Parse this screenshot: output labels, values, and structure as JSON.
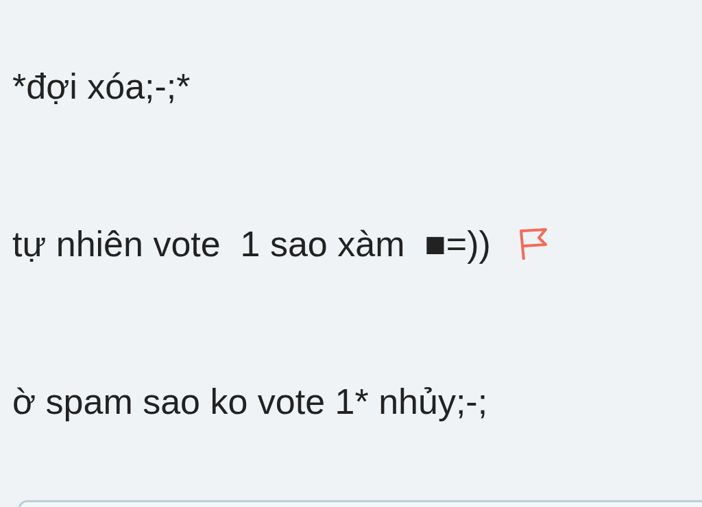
{
  "messages": [
    {
      "text": "*đợi xóa;-;*",
      "flagged": false
    },
    {
      "text": "tự nhiên vote  1 sao xàm  ■=))",
      "flagged": true
    },
    {
      "text": "ờ spam sao ko vote 1* nhủy;-;",
      "flagged": false
    }
  ]
}
